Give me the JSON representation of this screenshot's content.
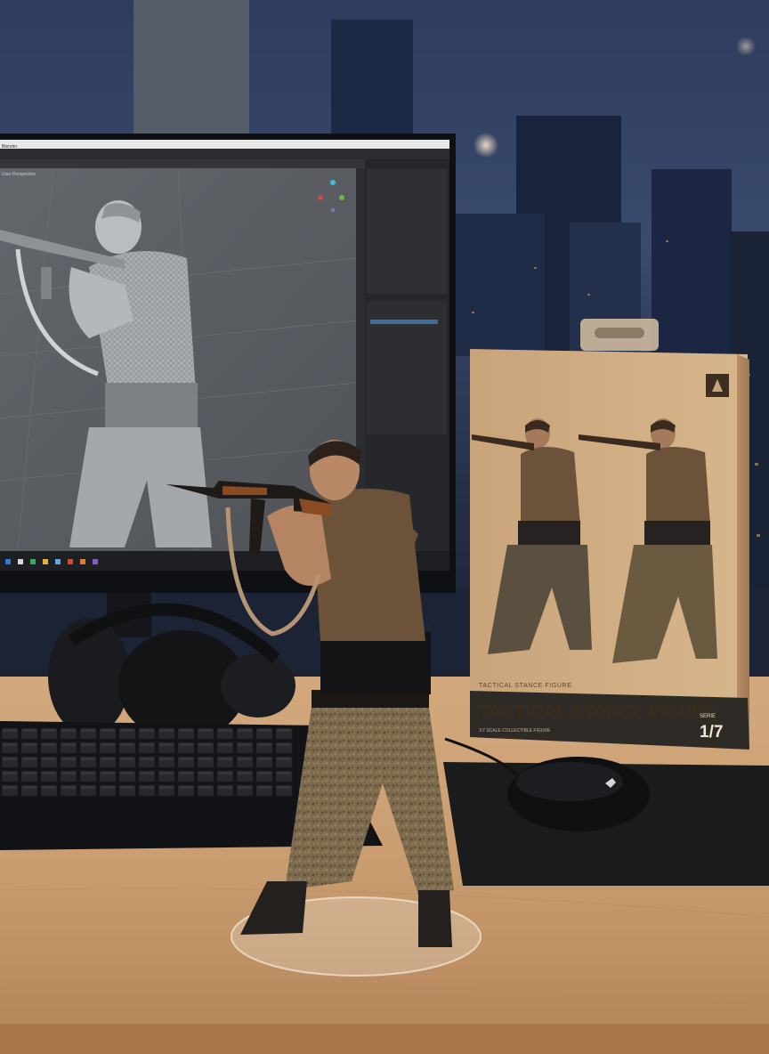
{
  "scene": {
    "description_type": "photo",
    "colors": {
      "night_sky": "#1f2a45",
      "desk_wood": "#c9a27a",
      "kraft_box": "#c8a57b",
      "box_band": "#2e2a26",
      "monitor_bezel": "#101215",
      "viewport_gray": "#5d6166"
    }
  },
  "monitor": {
    "window_title": "Blender",
    "viewport_label": "User Perspective"
  },
  "package": {
    "title": "TACTICAL STANCE FIGURE",
    "scale_series": "SERIE",
    "scale": "1/7",
    "subtitle": "TACTICAL STANCE FIGURE",
    "fine_print": "1/7 SCALE COLLECTIBLE FIGURE"
  }
}
